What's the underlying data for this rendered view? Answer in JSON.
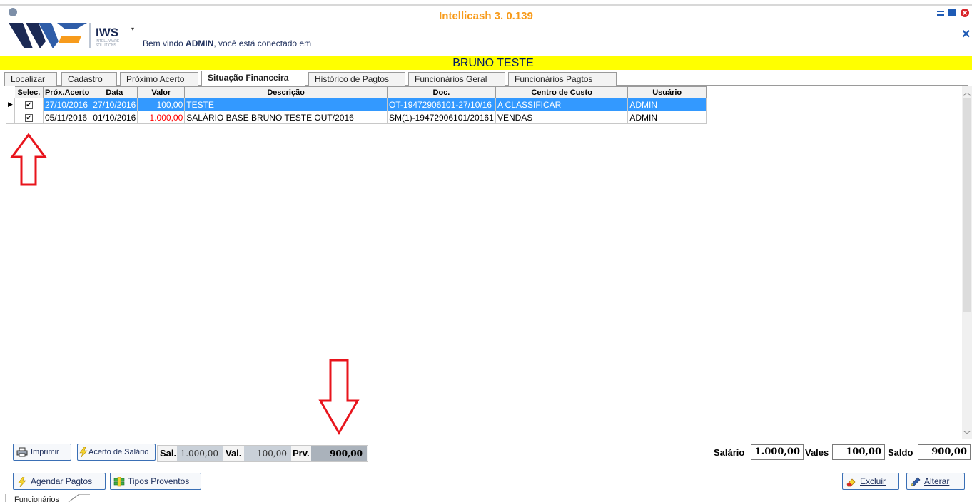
{
  "app": {
    "title": "Intellicash 3. 0.139",
    "logo_text": "IWS",
    "logo_sub": "INTELLIWARE SOLUTIONS",
    "welcome_prefix": "Bem vindo ",
    "welcome_user": "ADMIN",
    "welcome_suffix": ", você está conectado em"
  },
  "client_name": "BRUNO TESTE",
  "tabs": [
    {
      "label": "Localizar"
    },
    {
      "label": "Cadastro"
    },
    {
      "label": "Próximo Acerto"
    },
    {
      "label": "Situação Financeira"
    },
    {
      "label": "Histórico de Pagtos"
    },
    {
      "label": "Funcionários Geral"
    },
    {
      "label": "Funcionários Pagtos"
    }
  ],
  "active_tab": "Situação Financeira",
  "grid": {
    "columns": [
      "Selec.",
      "Próx.Acerto",
      "Data",
      "Valor",
      "Descrição",
      "Doc.",
      "Centro de Custo",
      "Usuário"
    ],
    "rows": [
      {
        "selected": true,
        "checked": true,
        "prox_acerto": "27/10/2016",
        "data": "27/10/2016",
        "valor": "100,00",
        "descricao": "TESTE",
        "doc": "OT-19472906101-27/10/16",
        "centro": "A CLASSIFICAR",
        "usuario": "ADMIN"
      },
      {
        "selected": false,
        "checked": true,
        "prox_acerto": "05/11/2016",
        "data": "01/10/2016",
        "valor": "1.000,00",
        "descricao": "SALÁRIO BASE BRUNO TESTE OUT/2016",
        "doc": "SM(1)-19472906101/20161",
        "centro": "VENDAS",
        "usuario": "ADMIN"
      }
    ]
  },
  "summary": {
    "print_label": "Imprimir",
    "acerto_label": "Acerto de Salário",
    "sal_label": "Sal.",
    "sal_value": "1.000,00",
    "val_label": "Val.",
    "val_value": "100,00",
    "prv_label": "Prv.",
    "prv_value": "900,00",
    "salario_label": "Salário",
    "salario_value": "1.000,00",
    "vales_label": "Vales",
    "vales_value": "100,00",
    "saldo_label": "Saldo",
    "saldo_value": "900,00"
  },
  "footer": {
    "agendar_label": "Agendar Pagtos",
    "tipos_label": "Tipos Proventos",
    "excluir_label": "Excluir",
    "alterar_label": "Alterar",
    "bottom_tab": "Funcionários"
  },
  "colors": {
    "title_orange": "#f79b1c",
    "client_bar": "#ffff00",
    "selection_blue": "#3399ff",
    "arrow_red": "#e8141c",
    "button_border": "#3a6fb5"
  }
}
